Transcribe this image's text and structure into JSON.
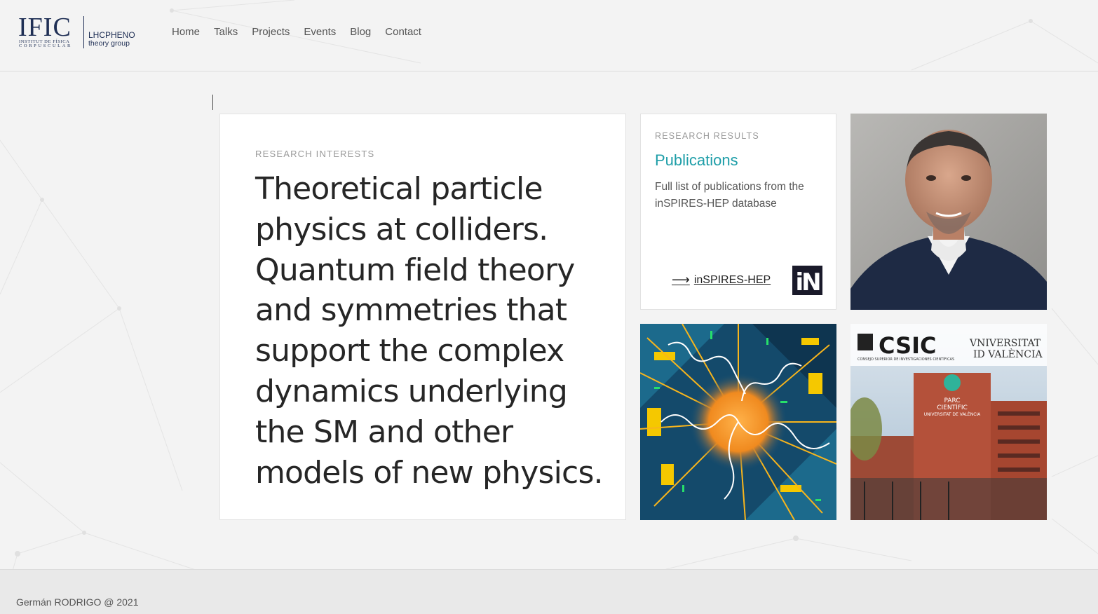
{
  "header": {
    "logo": {
      "brand": "IFIC",
      "sub_line1": "INSTITUT DE FÍSICA",
      "sub_line2": "CORPUSCULAR",
      "group_name": "LHCPHENO",
      "group_sub": "theory group"
    },
    "nav": [
      {
        "label": "Home"
      },
      {
        "label": "Talks"
      },
      {
        "label": "Projects"
      },
      {
        "label": "Events"
      },
      {
        "label": "Blog"
      },
      {
        "label": "Contact"
      }
    ]
  },
  "interests": {
    "eyebrow": "RESEARCH INTERESTS",
    "text": "Theoretical particle physics at colliders. Quantum field theory and symmetries that support the complex dynamics underlying the SM and other models of new physics."
  },
  "publications": {
    "eyebrow": "RESEARCH RESULTS",
    "title": "Publications",
    "description": "Full list of publications from the inSPIRES-HEP database",
    "link_arrow": "⟶",
    "link_label": "inSPIRES-HEP",
    "logo_text": "iN"
  },
  "csic_tile": {
    "csic": "CSIC",
    "csic_sub": "CONSEJO SUPERIOR DE INVESTIGACIONES CIENTÍFICAS",
    "uv_line1": "VNIVERSITAT",
    "uv_line2": "ID VALÈNCIA",
    "parc_line1": "PARC",
    "parc_line2": "CIENTÍFIC",
    "parc_line3": "UNIVERSITAT DE VALÈNCIA"
  },
  "footer": {
    "text": "Germán RODRIGO @ 2021"
  },
  "colors": {
    "accent": "#1e9ea8",
    "brand_navy": "#1f2f55",
    "background": "#f3f3f3"
  }
}
